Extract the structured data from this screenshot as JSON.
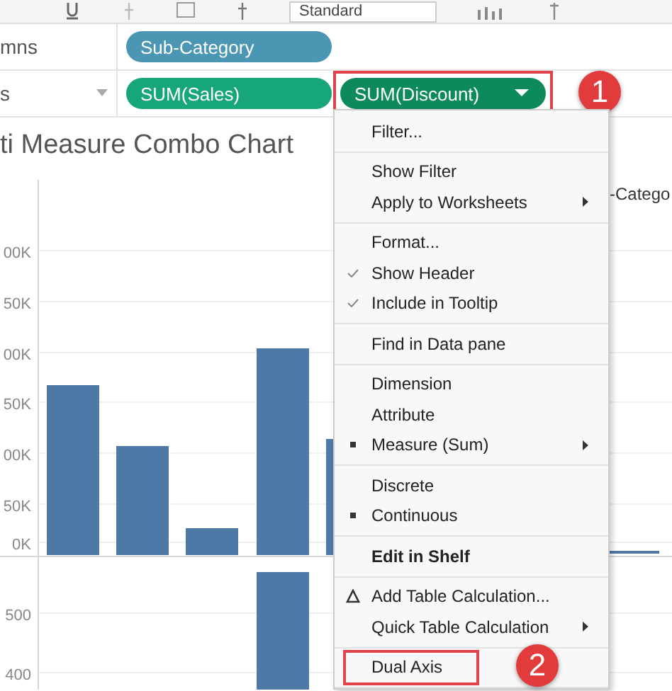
{
  "toolbar": {
    "dropdown": "Standard"
  },
  "shelves": [
    {
      "label": "mns",
      "pills": [
        {
          "text": "Sub-Category",
          "kind": "dimension",
          "caret": false,
          "outlined": false
        }
      ]
    },
    {
      "label": "s",
      "dropdown": true,
      "pills": [
        {
          "text": "SUM(Sales)",
          "kind": "measure",
          "caret": false,
          "outlined": false
        },
        {
          "text": "SUM(Discount)",
          "kind": "measure-active",
          "caret": true,
          "outlined": true,
          "callout": "1"
        }
      ]
    }
  ],
  "title": "ti Measure Combo Chart",
  "chart": {
    "column_header": "-Catego",
    "upper_axis_labels": [
      "00K",
      "50K",
      "00K",
      "50K",
      "00K",
      "50K",
      "0K"
    ],
    "lower_axis_labels": [
      "500",
      "400"
    ]
  },
  "menu": {
    "groups": [
      {
        "items": [
          {
            "label": "Filter...",
            "kind": "plain",
            "submenu": false,
            "bold": false,
            "outlined": false
          }
        ]
      },
      {
        "items": [
          {
            "label": "Show Filter",
            "kind": "plain",
            "submenu": false,
            "bold": false,
            "outlined": false
          },
          {
            "label": "Apply to Worksheets",
            "kind": "plain",
            "submenu": true,
            "bold": false,
            "outlined": false
          }
        ]
      },
      {
        "items": [
          {
            "label": "Format...",
            "kind": "plain",
            "submenu": false,
            "bold": false,
            "outlined": false
          },
          {
            "label": "Show Header",
            "kind": "check",
            "submenu": false,
            "bold": false,
            "outlined": false
          },
          {
            "label": "Include in Tooltip",
            "kind": "check",
            "submenu": false,
            "bold": false,
            "outlined": false
          }
        ]
      },
      {
        "items": [
          {
            "label": "Find in Data pane",
            "kind": "plain",
            "submenu": false,
            "bold": false,
            "outlined": false
          }
        ]
      },
      {
        "items": [
          {
            "label": "Dimension",
            "kind": "plain",
            "submenu": false,
            "bold": false,
            "outlined": false
          },
          {
            "label": "Attribute",
            "kind": "plain",
            "submenu": false,
            "bold": false,
            "outlined": false
          },
          {
            "label": "Measure (Sum)",
            "kind": "bullet",
            "submenu": true,
            "bold": false,
            "outlined": false
          }
        ]
      },
      {
        "items": [
          {
            "label": "Discrete",
            "kind": "plain",
            "submenu": false,
            "bold": false,
            "outlined": false
          },
          {
            "label": "Continuous",
            "kind": "bullet",
            "submenu": false,
            "bold": false,
            "outlined": false
          }
        ]
      },
      {
        "items": [
          {
            "label": "Edit in Shelf",
            "kind": "plain",
            "submenu": false,
            "bold": true,
            "outlined": false
          }
        ]
      },
      {
        "items": [
          {
            "label": "Add Table Calculation...",
            "kind": "delta",
            "submenu": false,
            "bold": false,
            "outlined": false
          },
          {
            "label": "Quick Table Calculation",
            "kind": "plain",
            "submenu": true,
            "bold": false,
            "outlined": false
          }
        ]
      },
      {
        "items": [
          {
            "label": "Dual Axis",
            "kind": "plain",
            "submenu": false,
            "bold": false,
            "outlined": true,
            "callout": "2"
          }
        ]
      }
    ]
  }
}
